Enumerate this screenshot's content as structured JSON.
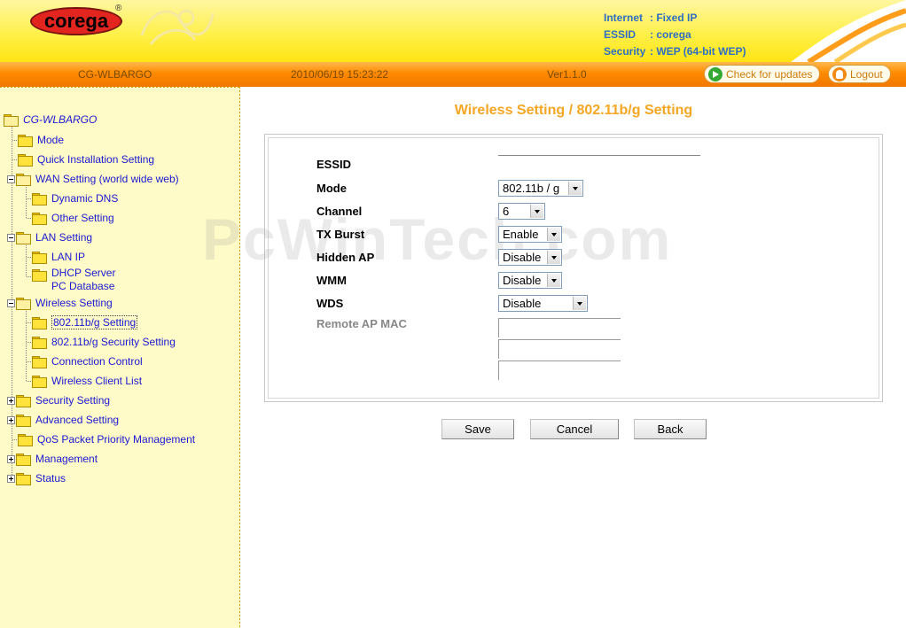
{
  "header": {
    "logo_text": "corega",
    "logo_reg": "®",
    "internet_label": "Internet",
    "internet_value": "Fixed IP",
    "essid_label": "ESSID",
    "essid_value": "corega",
    "security_label": "Security",
    "security_value": "WEP (64-bit WEP)"
  },
  "bar": {
    "device": "CG-WLBARGO",
    "datetime": "2010/06/19 15:23:22",
    "version": "Ver1.1.0",
    "check_updates": "Check for updates",
    "logout": "Logout"
  },
  "sidebar": {
    "root": "CG-WLBARGO",
    "items": [
      {
        "label": "Mode"
      },
      {
        "label": "Quick Installation Setting"
      },
      {
        "label": "WAN Setting (world wide web)"
      },
      {
        "label": "Dynamic DNS"
      },
      {
        "label": "Other Setting"
      },
      {
        "label": "LAN Setting"
      },
      {
        "label": "LAN IP"
      },
      {
        "label": "DHCP Server"
      },
      {
        "label": "PC Database"
      },
      {
        "label": "Wireless Setting"
      },
      {
        "label": "802.11b/g Setting"
      },
      {
        "label": "802.11b/g Security Setting"
      },
      {
        "label": "Connection Control"
      },
      {
        "label": "Wireless Client List"
      },
      {
        "label": "Security Setting"
      },
      {
        "label": "Advanced Setting"
      },
      {
        "label": "QoS Packet Priority Management"
      },
      {
        "label": "Management"
      },
      {
        "label": "Status"
      }
    ]
  },
  "main": {
    "title": "Wireless Setting / 802.11b/g Setting",
    "watermark": "PcWinTech.com",
    "fields": {
      "essid": {
        "label": "ESSID",
        "value": ""
      },
      "mode": {
        "label": "Mode",
        "value": "802.11b / g"
      },
      "channel": {
        "label": "Channel",
        "value": "6"
      },
      "tx_burst": {
        "label": "TX Burst",
        "value": "Enable"
      },
      "hidden_ap": {
        "label": "Hidden AP",
        "value": "Disable"
      },
      "wmm": {
        "label": "WMM",
        "value": "Disable"
      },
      "wds": {
        "label": "WDS",
        "value": "Disable"
      },
      "remote_ap_mac": {
        "label": "Remote AP MAC"
      }
    },
    "buttons": {
      "save": "Save",
      "cancel": "Cancel",
      "back": "Back"
    }
  },
  "colors": {
    "title_orange": "#f5a623",
    "link_blue": "#1a1ad0",
    "bar_orange": "#ff8a00",
    "header_yellow": "#fff04a"
  }
}
